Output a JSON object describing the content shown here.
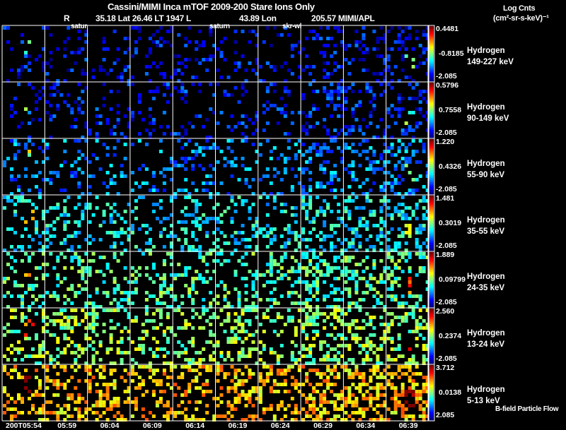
{
  "header": {
    "title": "Cassini/MIMI Inca mTOF  2009-200    Stare    Ions Only",
    "line2_r": "R",
    "line2_mid": "35.18 Lat 26.46 LT 1947 L",
    "line2_lon": "43.89 Lon",
    "line2_right": "205.57  MIMI/APL",
    "overlay_labels": [
      "satur",
      "saturn",
      "skr-wl"
    ]
  },
  "units": {
    "line1": "Log Cnts",
    "line2": "(cm²-sr-s-keV)⁻¹"
  },
  "footer_note": "B-field Particle Flow",
  "chart_data": {
    "type": "heatmap",
    "title": "Cassini/MIMI Inca mTOF 2009-200 Stare Ions Only",
    "columns": [
      "200T05:54",
      "05:59",
      "06:04",
      "06:09",
      "06:14",
      "06:19",
      "06:24",
      "06:29",
      "06:34",
      "06:39"
    ],
    "rows": [
      {
        "species": "Hydrogen",
        "energy": "149-227 keV",
        "cmax": "0.4481",
        "cmid": "-0.8185",
        "cmin": "-2.085",
        "level": 0.12
      },
      {
        "species": "Hydrogen",
        "energy": "90-149 keV",
        "cmax": "0.5796",
        "cmid": "0.7558",
        "cmin": "-2.085",
        "level": 0.14
      },
      {
        "species": "Hydrogen",
        "energy": "55-90 keV",
        "cmax": "1.220",
        "cmid": "0.4326",
        "cmin": "-2.085",
        "level": 0.26
      },
      {
        "species": "Hydrogen",
        "energy": "35-55 keV",
        "cmax": "1.481",
        "cmid": "0.3019",
        "cmin": "-2.085",
        "level": 0.36
      },
      {
        "species": "Hydrogen",
        "energy": "24-35 keV",
        "cmax": "1.889",
        "cmid": "0.09799",
        "cmin": "-2.085",
        "level": 0.45
      },
      {
        "species": "Hydrogen",
        "energy": "13-24 keV",
        "cmax": "2.560",
        "cmid": "0.2374",
        "cmin": "-2.085",
        "level": 0.52
      },
      {
        "species": "Hydrogen",
        "energy": "5-13 keV",
        "cmax": "3.712",
        "cmid": "0.0138",
        "cmin": "2.085",
        "level": 0.68
      }
    ]
  }
}
